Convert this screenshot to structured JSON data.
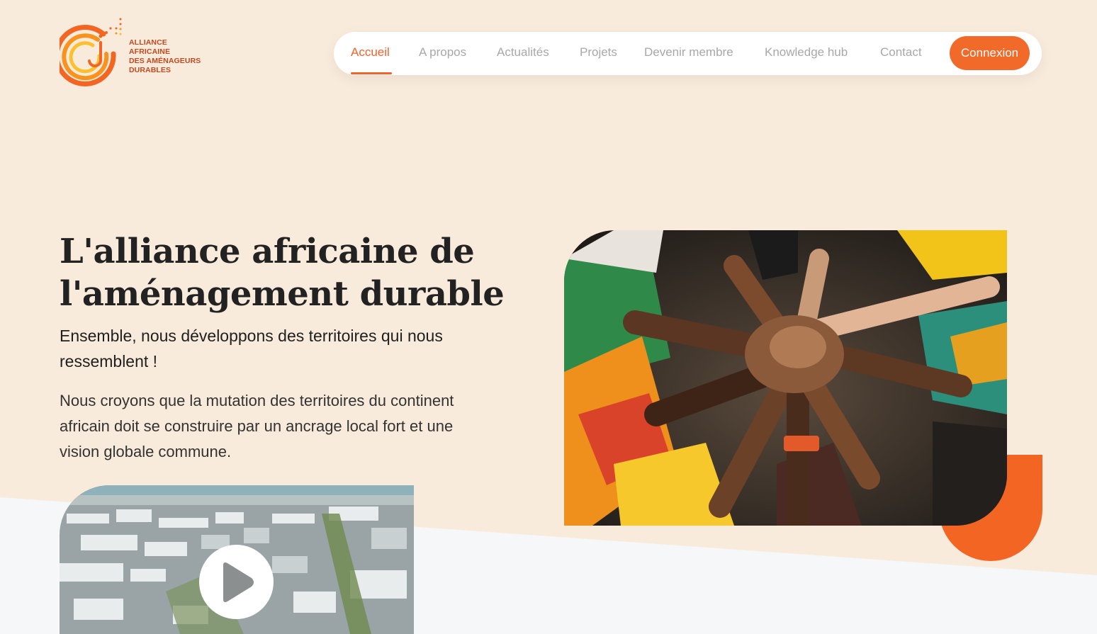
{
  "logo": {
    "lines": [
      "ALLIANCE",
      "AFRICAINE",
      "DES AMÉNAGEURS",
      "DURABLES"
    ]
  },
  "nav": {
    "items": [
      {
        "label": "Accueil",
        "active": true
      },
      {
        "label": "A propos",
        "active": false
      },
      {
        "label": "Actualités",
        "active": false
      },
      {
        "label": "Projets",
        "active": false
      },
      {
        "label": "Devenir membre",
        "active": false
      },
      {
        "label": "Knowledge hub",
        "active": false
      },
      {
        "label": "Contact",
        "active": false
      }
    ],
    "login_label": "Connexion"
  },
  "hero": {
    "title_line1": "L'alliance africaine de",
    "title_line2": "l'aménagement durable",
    "subtitle_line1": "Ensemble, nous développons des territoires qui nous",
    "subtitle_line2": "ressemblent !",
    "body_line1": "Nous croyons que la mutation des territoires du continent",
    "body_line2": "africain doit se construire par un ancrage local fort et une",
    "body_line3": "vision globale commune."
  },
  "colors": {
    "accent": "#f26522",
    "background": "#f9ebdb",
    "band": "#f6f7f8",
    "nav_text": "#a8a8a8"
  },
  "icons": {
    "logo": "alliance-logo-icon",
    "play": "play-icon"
  }
}
